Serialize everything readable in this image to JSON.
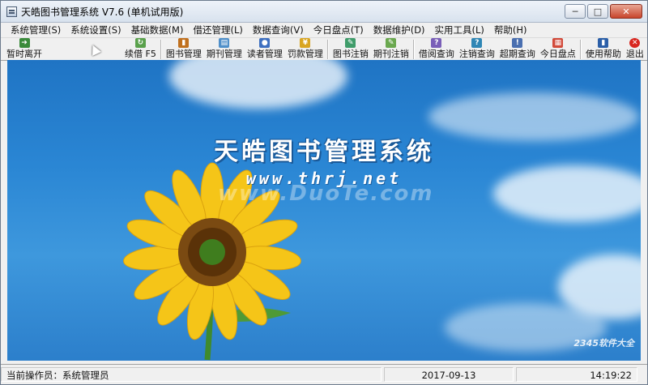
{
  "window": {
    "title": "天皓图书管理系统 V7.6 (单机试用版)"
  },
  "menu": [
    "系统管理(S)",
    "系统设置(S)",
    "基础数据(M)",
    "借还管理(L)",
    "数据查询(V)",
    "今日盘点(T)",
    "数据维护(D)",
    "实用工具(L)",
    "帮助(H)"
  ],
  "toolbar": {
    "leave": "暂时离开",
    "renew": "续借 F5",
    "books": "图书管理",
    "periodicals": "期刊管理",
    "readers": "读者管理",
    "fines": "罚款管理",
    "book_cancel": "图书注销",
    "periodical_cancel": "期刊注销",
    "borrow_query": "借阅查询",
    "cancel_query": "注销查询",
    "overdue_query": "超期查询",
    "inventory": "今日盘点",
    "help": "使用帮助",
    "exit": "退出"
  },
  "main": {
    "hero_title": "天皓图书管理系统",
    "hero_url": "www.thrj.net",
    "watermark": "www.DuoTe.com",
    "corner_watermark": "2345软件大全"
  },
  "status": {
    "operator": "当前操作员：系统管理员",
    "date": "2017-09-13",
    "time": "14:19:22"
  }
}
